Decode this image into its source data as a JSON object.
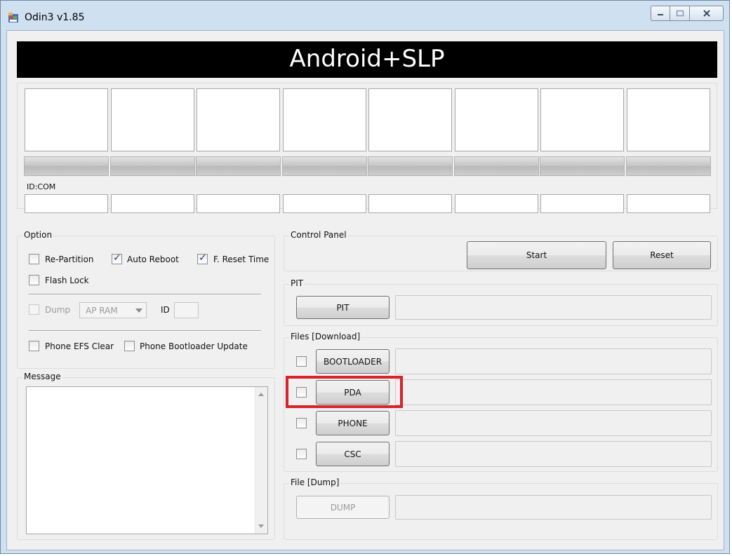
{
  "window": {
    "title": "Odin3 v1.85",
    "app_icon": "odin-app-icon"
  },
  "banner": {
    "text": "Android+SLP"
  },
  "ports": {
    "count": 8,
    "idcom_label": "ID:COM"
  },
  "option": {
    "label": "Option",
    "re_partition": {
      "label": "Re-Partition",
      "checked": false
    },
    "auto_reboot": {
      "label": "Auto Reboot",
      "checked": true
    },
    "f_reset_time": {
      "label": "F. Reset Time",
      "checked": true
    },
    "flash_lock": {
      "label": "Flash Lock",
      "checked": false
    },
    "dump": {
      "label": "Dump",
      "checked": false,
      "enabled": false
    },
    "dump_select": {
      "value": "AP RAM"
    },
    "id_label": "ID",
    "phone_efs_clear": {
      "label": "Phone EFS Clear",
      "checked": false
    },
    "phone_bootloader_update": {
      "label": "Phone Bootloader Update",
      "checked": false
    }
  },
  "message": {
    "label": "Message",
    "text": ""
  },
  "control_panel": {
    "label": "Control Panel",
    "start": "Start",
    "reset": "Reset"
  },
  "pit": {
    "label": "PIT",
    "button": "PIT"
  },
  "files": {
    "label": "Files [Download]",
    "bootloader": "BOOTLOADER",
    "pda": "PDA",
    "phone": "PHONE",
    "csc": "CSC"
  },
  "file_dump": {
    "label": "File [Dump]",
    "button": "DUMP"
  },
  "colors": {
    "banner_bg": "#000000",
    "banner_text": "#ffffff",
    "highlight": "#d7232b"
  }
}
